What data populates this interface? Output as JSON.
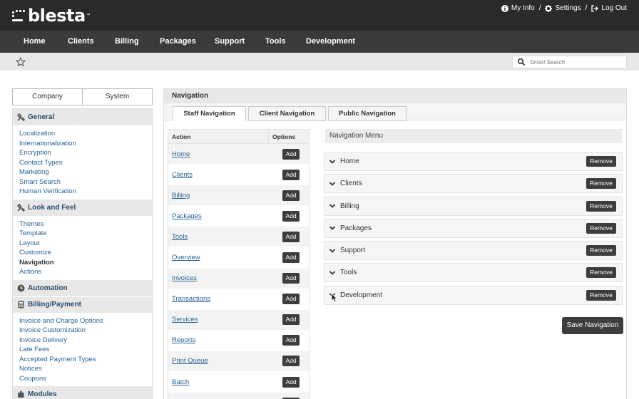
{
  "header": {
    "logo": "blesta",
    "logo_tm": "™",
    "links": [
      {
        "label": "My Info",
        "icon": "info-icon"
      },
      {
        "label": "Settings",
        "icon": "gear-icon"
      },
      {
        "label": "Log Out",
        "icon": "logout-icon"
      }
    ],
    "separator": "/"
  },
  "navbar": {
    "items": [
      "Home",
      "Clients",
      "Billing",
      "Packages",
      "Support",
      "Tools",
      "Development"
    ]
  },
  "search": {
    "placeholder": "Smart Search"
  },
  "segment": {
    "company": "Company",
    "system": "System"
  },
  "sidebar": {
    "groups": [
      {
        "title": "General",
        "icon": "tools-icon",
        "items": [
          "Localization",
          "Internationalization",
          "Encryption",
          "Contact Types",
          "Marketing",
          "Smart Search",
          "Human Verification"
        ]
      },
      {
        "title": "Look and Feel",
        "icon": "tools-icon",
        "items": [
          "Themes",
          "Template",
          "Layout",
          "Customize",
          "Navigation",
          "Actions"
        ],
        "active": "Navigation"
      },
      {
        "title": "Automation",
        "icon": "clock-icon",
        "items": []
      },
      {
        "title": "Billing/Payment",
        "icon": "calculator-icon",
        "items": [
          "Invoice and Charge Options",
          "Invoice Customization",
          "Invoice Delivery",
          "Late Fees",
          "Accepted Payment Types",
          "Notices",
          "Coupons"
        ]
      },
      {
        "title": "Modules",
        "icon": "puzzle-icon",
        "items": []
      }
    ]
  },
  "main": {
    "title": "Navigation",
    "tabs": [
      "Staff Navigation",
      "Client Navigation",
      "Public Navigation"
    ],
    "active_tab": "Staff Navigation",
    "action_table": {
      "col_action": "Action",
      "col_options": "Options",
      "add_label": "Add",
      "rows": [
        "Home",
        "Clients",
        "Billing",
        "Packages",
        "Tools",
        "Overview",
        "Invoices",
        "Transactions",
        "Services",
        "Reports",
        "Print Queue",
        "Batch",
        ""
      ]
    },
    "nav_menu": {
      "title": "Navigation Menu",
      "remove_label": "Remove",
      "items": [
        "Home",
        "Clients",
        "Billing",
        "Packages",
        "Support",
        "Tools",
        "Development"
      ]
    },
    "save_label": "Save Navigation"
  },
  "colors": {
    "header_bg": "#2a2a2a",
    "navbar_bg": "#3a3a3a",
    "link": "#2a6496",
    "group_title": "#2a4d6e",
    "button_bg": "#3d3d3d"
  }
}
